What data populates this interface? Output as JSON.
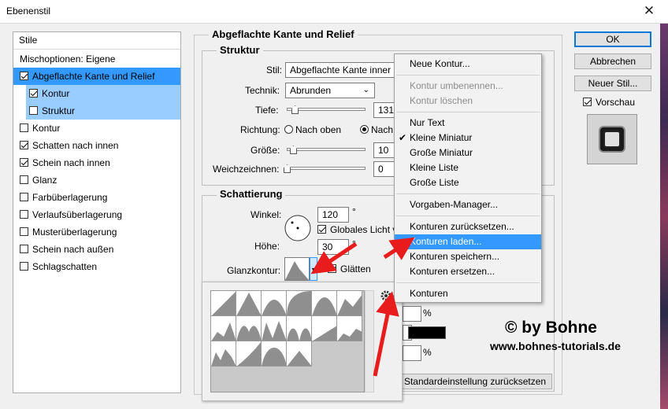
{
  "window": {
    "title": "Ebenenstil",
    "close_glyph": "✕"
  },
  "styles_panel": {
    "header": "Stile",
    "items": [
      {
        "label": "Mischoptionen: Eigene",
        "checkbox": false,
        "checked": false,
        "state": "none"
      },
      {
        "label": "Abgeflachte Kante und Relief",
        "checkbox": true,
        "checked": true,
        "state": "selected"
      },
      {
        "label": "Kontur",
        "checkbox": true,
        "checked": true,
        "state": "subselected",
        "indent": true
      },
      {
        "label": "Struktur",
        "checkbox": true,
        "checked": false,
        "state": "subselected",
        "indent": true
      },
      {
        "label": "Kontur",
        "checkbox": true,
        "checked": false,
        "state": "none"
      },
      {
        "label": "Schatten nach innen",
        "checkbox": true,
        "checked": true,
        "state": "none"
      },
      {
        "label": "Schein nach innen",
        "checkbox": true,
        "checked": true,
        "state": "none"
      },
      {
        "label": "Glanz",
        "checkbox": true,
        "checked": false,
        "state": "none"
      },
      {
        "label": "Farbüberlagerung",
        "checkbox": true,
        "checked": false,
        "state": "none"
      },
      {
        "label": "Verlaufsüberlagerung",
        "checkbox": true,
        "checked": false,
        "state": "none"
      },
      {
        "label": "Musterüberlagerung",
        "checkbox": true,
        "checked": false,
        "state": "none"
      },
      {
        "label": "Schein nach außen",
        "checkbox": true,
        "checked": false,
        "state": "none"
      },
      {
        "label": "Schlagschatten",
        "checkbox": true,
        "checked": false,
        "state": "none"
      }
    ]
  },
  "bevel": {
    "title": "Abgeflachte Kante und Relief",
    "structure_title": "Struktur",
    "stil_label": "Stil:",
    "stil_value": "Abgeflachte Kante inner",
    "technik_label": "Technik:",
    "technik_value": "Abrunden",
    "tiefe_label": "Tiefe:",
    "tiefe_value": "131",
    "richtung_label": "Richtung:",
    "richtung_up": "Nach oben",
    "richtung_down": "Nach",
    "groesse_label": "Größe:",
    "groesse_value": "10",
    "weich_label": "Weichzeichnen:",
    "weich_value": "0",
    "slider_levels": {
      "tiefe": 0.1,
      "groesse": 0.08,
      "weich": 0.0
    }
  },
  "shading": {
    "title": "Schattierung",
    "winkel_label": "Winkel:",
    "winkel_value": "120",
    "degree": "°",
    "global_label": "Globales Licht v",
    "hoehe_label": "Höhe:",
    "hoehe_value": "30",
    "glanz_label": "Glanzkontur:",
    "glaetten_label": "Glätten",
    "percent": "%",
    "reset_label": "Standardeinstellung zurücksetzen"
  },
  "buttons": {
    "ok": "OK",
    "cancel": "Abbrechen",
    "new_style": "Neuer Stil...",
    "preview": "Vorschau"
  },
  "context_menu": [
    {
      "label": "Neue Kontur...",
      "type": "item"
    },
    {
      "type": "sep"
    },
    {
      "label": "Kontur umbenennen...",
      "type": "disabled"
    },
    {
      "label": "Kontur löschen",
      "type": "disabled"
    },
    {
      "type": "sep"
    },
    {
      "label": "Nur Text",
      "type": "item"
    },
    {
      "label": "Kleine Miniatur",
      "type": "checked"
    },
    {
      "label": "Große Miniatur",
      "type": "item"
    },
    {
      "label": "Kleine Liste",
      "type": "item"
    },
    {
      "label": "Große Liste",
      "type": "item"
    },
    {
      "type": "sep"
    },
    {
      "label": "Vorgaben-Manager...",
      "type": "item"
    },
    {
      "type": "sep"
    },
    {
      "label": "Konturen zurücksetzen...",
      "type": "item"
    },
    {
      "label": "Konturen laden...",
      "type": "highlight"
    },
    {
      "label": "Konturen speichern...",
      "type": "item"
    },
    {
      "label": "Konturen ersetzen...",
      "type": "item"
    },
    {
      "type": "sep"
    },
    {
      "label": "Konturen",
      "type": "item"
    }
  ],
  "watermark": {
    "line1": "© by Bohne",
    "line2": "www.bohnes-tutorials.de"
  },
  "colors": {
    "selection": "#3399ff",
    "subselection": "#99ccff",
    "arrow": "#e81c1c"
  },
  "icons": {
    "gear": "gear-icon",
    "dropdown": "chevron-down-icon"
  }
}
